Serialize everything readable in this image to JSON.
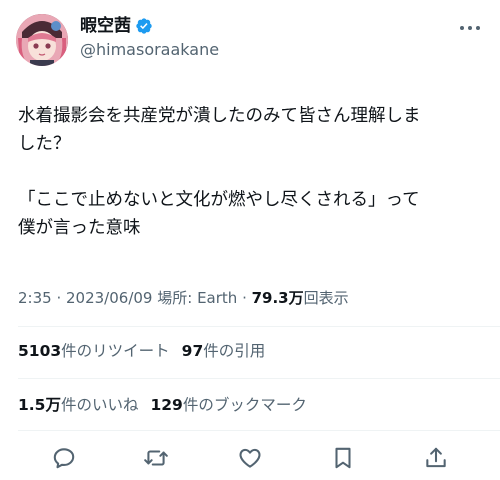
{
  "user": {
    "display_name": "暇空茜",
    "handle": "@himasoraakane",
    "verified": true,
    "avatar_icon": "user-avatar"
  },
  "tweet": {
    "line1": "水着撮影会を共産党が潰したのみて皆さん理解しま",
    "line2": "した？",
    "line3": "「ここで止めないと文化が燃やし尽くされる」って",
    "line4": "僕が言った意味"
  },
  "meta": {
    "time": "2:35",
    "date": "2023/06/09",
    "location_label": "場所: Earth",
    "separator": " · ",
    "views_count": "79.3万",
    "views_label": "回表示"
  },
  "stats": {
    "retweets_count": "5103",
    "retweets_label": "件のリツイート",
    "quotes_count": "97",
    "quotes_label": "件の引用",
    "likes_count": "1.5万",
    "likes_label": "件のいいね",
    "bookmarks_count": "129",
    "bookmarks_label": "件のブックマーク"
  },
  "colors": {
    "text_primary": "#0f1419",
    "text_secondary": "#536471",
    "verified_blue": "#1d9bf0",
    "divider": "#eff3f4"
  },
  "actions": [
    "reply-icon",
    "retweet-icon",
    "like-icon",
    "bookmark-icon",
    "share-icon"
  ]
}
